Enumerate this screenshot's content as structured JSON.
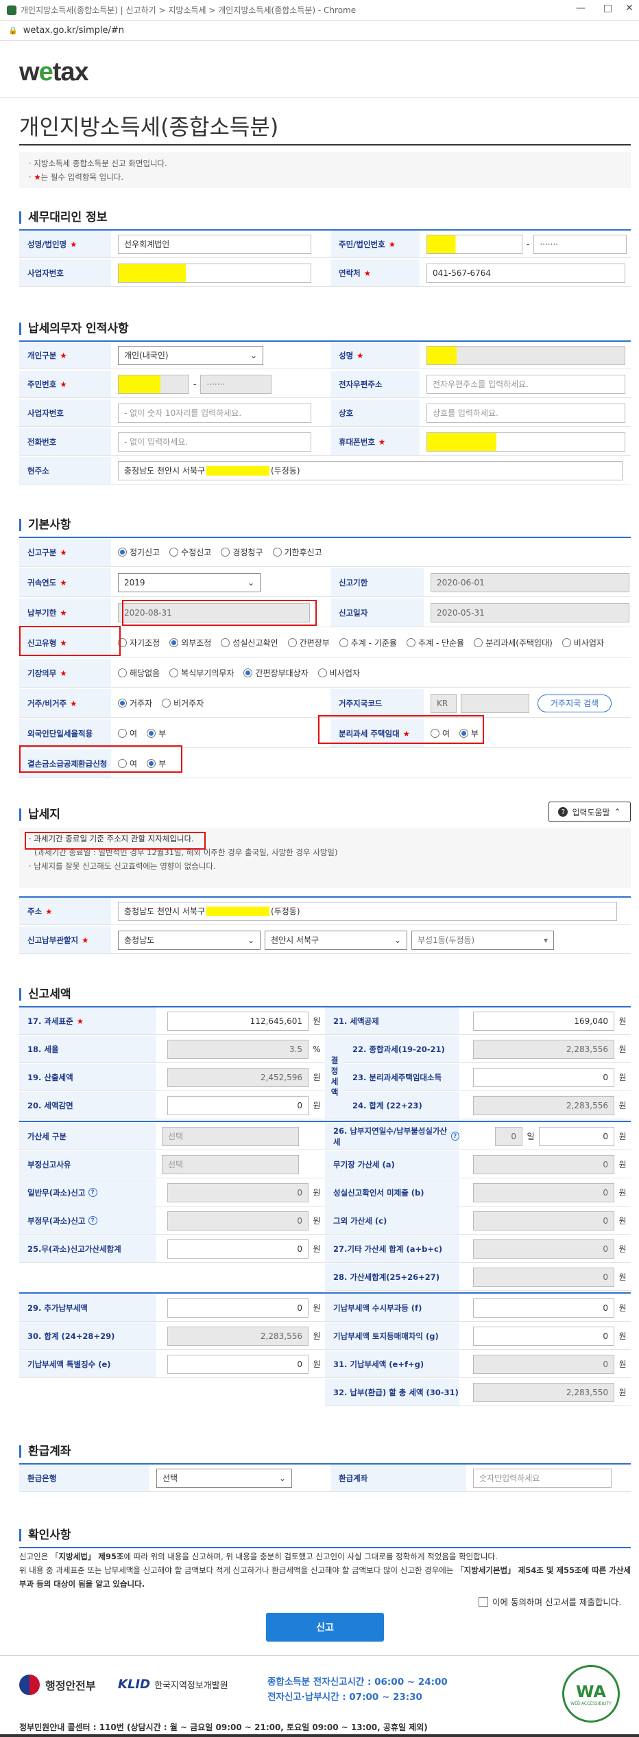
{
  "browser": {
    "title": "개인지방소득세(종합소득분) | 신고하기 > 지방소득세 > 개인지방소득세(종합소득분) - Chrome",
    "url": "wetax.go.kr/simple/#n"
  },
  "logo": {
    "pre": "w",
    "mid": "e",
    "post": "tax"
  },
  "page": {
    "title": "개인지방소득세(종합소득분)",
    "notice1": "· 지방소득세 종합소득분 신고 화면입니다.",
    "notice2_pre": "· ",
    "notice2_star": "★",
    "notice2_post": "는 필수 입력항목 입니다."
  },
  "agent": {
    "title": "세무대리인 정보",
    "name_label": "성명/법인명",
    "name_value": "선우회계법인",
    "rrn_label": "주민/법인번호",
    "rrn_back": "·······",
    "biz_label": "사업자번호",
    "phone_label": "연락처",
    "phone_value": "041-567-6764"
  },
  "taxpayer": {
    "title": "납세의무자 인적사항",
    "type_label": "개인구분",
    "type_value": "개인(내국인)",
    "name_label": "성명",
    "rrn_label": "주민번호",
    "rrn_back": "·······",
    "email_label": "전자우편주소",
    "email_ph": "전자우편주소를 입력하세요.",
    "biz_label": "사업자번호",
    "biz_ph": "- 없이 숫자 10자리를 입력하세요.",
    "shop_label": "상호",
    "shop_ph": "상호를 입력하세요.",
    "tel_label": "전화번호",
    "tel_ph": "- 없이 입력하세요.",
    "mobile_label": "휴대폰번호",
    "addr_label": "현주소",
    "addr_pre": "충청남도 천안시 서북구",
    "addr_post": "(두정동)"
  },
  "basic": {
    "title": "기본사항",
    "rtype_label": "신고구분",
    "rtype_opts": [
      "정기신고",
      "수정신고",
      "경정청구",
      "기한후신고"
    ],
    "rtype_sel": 0,
    "year_label": "귀속연도",
    "year_value": "2019",
    "deadline_label": "신고기한",
    "deadline_value": "2020-06-01",
    "paydue_label": "납부기한",
    "paydue_value": "2020-08-31",
    "rdate_label": "신고일자",
    "rdate_value": "2020-05-31",
    "rkind_label": "신고유형",
    "rkind_opts": [
      "자기조정",
      "외부조정",
      "성실신고확인",
      "간편장부",
      "추계 - 기준율",
      "추계 - 단순율",
      "분리과세(주택임대)",
      "비사업자"
    ],
    "rkind_sel": 1,
    "book_label": "기장의무",
    "book_opts": [
      "해당없음",
      "복식부기의무자",
      "간편장부대상자",
      "비사업자"
    ],
    "book_sel": 2,
    "resid_label": "거주/비거주",
    "resid_opts": [
      "거주자",
      "비거주자"
    ],
    "resid_sel": 0,
    "country_label": "거주지국코드",
    "country_value": "KR",
    "country_btn": "거주지국 검색",
    "foreign_label": "외국인단일세율적용",
    "foreign_opts": [
      "여",
      "부"
    ],
    "foreign_sel": 1,
    "sep_label": "분리과세 주택임대",
    "sep_opts": [
      "여",
      "부"
    ],
    "sep_sel": 1,
    "loss_label": "결손금소급공제환급신청",
    "loss_opts": [
      "여",
      "부"
    ],
    "loss_sel": 1
  },
  "taxplace": {
    "title": "납세지",
    "help_btn": "입력도움말",
    "line1": "· 과세기간 종료일 기준 주소지 관할 지자체입니다.",
    "line2": "(과세기간 종료일 : 일반적인 경우 12월31일, 해외 이주한 경우 출국일, 사망한 경우 사망일)",
    "line3": "· 납세지를 잘못 신고해도 신고효력에는 영향이 없습니다.",
    "addr_label": "주소",
    "addr_pre": "충청남도 천안시 서북구",
    "addr_post": "(두정동)",
    "office_label": "신고납부관할지",
    "sido": "충청남도",
    "sigungu": "천안시 서북구",
    "dong": "부성1동(두정동)"
  },
  "amount": {
    "title": "신고세액",
    "r17_label": "17. 과세표준",
    "r17_value": "112,645,601",
    "r17_unit": "원",
    "r21_label": "21. 세액공제",
    "r21_value": "169,040",
    "r21_unit": "원",
    "r18_label": "18. 세율",
    "r18_value": "3.5",
    "r18_unit": "%",
    "r22_label": "22. 종합과세(19-20-21)",
    "r22_value": "2,283,556",
    "r22_unit": "원",
    "r19_label": "19. 산출세액",
    "r19_value": "2,452,596",
    "r19_unit": "원",
    "r23_label": "23. 분리과세주택임대소득",
    "r23_value": "0",
    "r23_unit": "원",
    "r20_label": "20. 세액감면",
    "r20_value": "0",
    "r20_unit": "원",
    "r24_label": "24. 합계 (22+23)",
    "r24_value": "2,283,556",
    "r24_unit": "원",
    "group_label": "결정세액",
    "add_kind_label": "가산세 구분",
    "add_kind_value": "선택",
    "r26_label": "26. 납부지연일수/납부불성실가산세",
    "r26_days": "0",
    "r26_days_unit": "일",
    "r26_value": "0",
    "r26_unit": "원",
    "reason_label": "부정신고사유",
    "reason_value": "선택",
    "nobook_label": "무기장 가산세 (a)",
    "nobook_value": "0",
    "nobook_unit": "원",
    "general_label": "일반무(과소)신고",
    "general_value": "0",
    "general_unit": "원",
    "diligent_label": "성실신고확인서 미제출 (b)",
    "diligent_value": "0",
    "diligent_unit": "원",
    "fraud_label": "부정무(과소)신고",
    "fraud_value": "0",
    "fraud_unit": "원",
    "other_label": "그외 가산세 (c)",
    "other_value": "0",
    "other_unit": "원",
    "r25_label": "25.무(과소)신고가산세합계",
    "r25_value": "0",
    "r25_unit": "원",
    "r27_label": "27.기타 가산세 합계 (a+b+c)",
    "r27_value": "0",
    "r27_unit": "원",
    "r28_label": "28. 가산세합계(25+26+27)",
    "r28_value": "0",
    "r28_unit": "원",
    "r29_label": "29. 추가납부세액",
    "r29_value": "0",
    "r29_unit": "원",
    "paid_label": "기납부세액 수시부과등 (f)",
    "paid_value": "0",
    "paid_unit": "원",
    "r30_label": "30. 합계 (24+28+29)",
    "r30_value": "2,283,556",
    "r30_unit": "원",
    "land_label": "기납부세액 토지등매매차익 (g)",
    "land_value": "0",
    "land_unit": "원",
    "special_label": "기납부세액 특별징수 (e)",
    "special_value": "0",
    "special_unit": "원",
    "r31_label": "31. 기납부세액 (e+f+g)",
    "r31_value": "0",
    "r31_unit": "원",
    "r32_label": "32. 납부(환급) 할 총 세액 (30-31)",
    "r32_value": "2,283,550",
    "r32_unit": "원"
  },
  "refund": {
    "title": "환급계좌",
    "bank_label": "환급은행",
    "bank_value": "선택",
    "acct_label": "환급계좌",
    "acct_ph": "숫자만입력하세요"
  },
  "confirm": {
    "title": "확인사항",
    "text1_pre": "신고인은 「",
    "text1_b": "지방세법」 제95조",
    "text1_post": "에 따라 위의 내용을 신고하며, 위 내용을 충분히 검토했고 신고인이 사실 그대로를 정확하게 적었음을 확인합니다.",
    "text2_pre": "위 내용 중 과세표준 또는 납부세액을 신고해야 할 금액보다 적게 신고하거나 환급세액을 신고해야 할 금액보다 많이 신고한 경우에는 「",
    "text2_b": "지방세기본법」 제54조 및 제55조에 따른 가산세 부과 등의 대상이 됨을 알고 있습니다.",
    "agree": "이에 동의하며 신고서를 제출합니다.",
    "submit": "신고"
  },
  "footer": {
    "ministry": "행정안전부",
    "klid": "한국지역정보개발원",
    "time1": "종합소득분 전자신고시간 : 06:00 ~ 24:00",
    "time2": "전자신고·납부시간 : 07:00 ~ 23:30",
    "callcenter": "정부민원안내 콜센터 : 110번 (상담시간 : 월 ~ 금요일 09:00 ~ 21:00, 토요일 09:00 ~ 13:00, 공휴일 제외)",
    "wa": "WA",
    "wa_sub": "WEB ACCESSIBILITY"
  }
}
